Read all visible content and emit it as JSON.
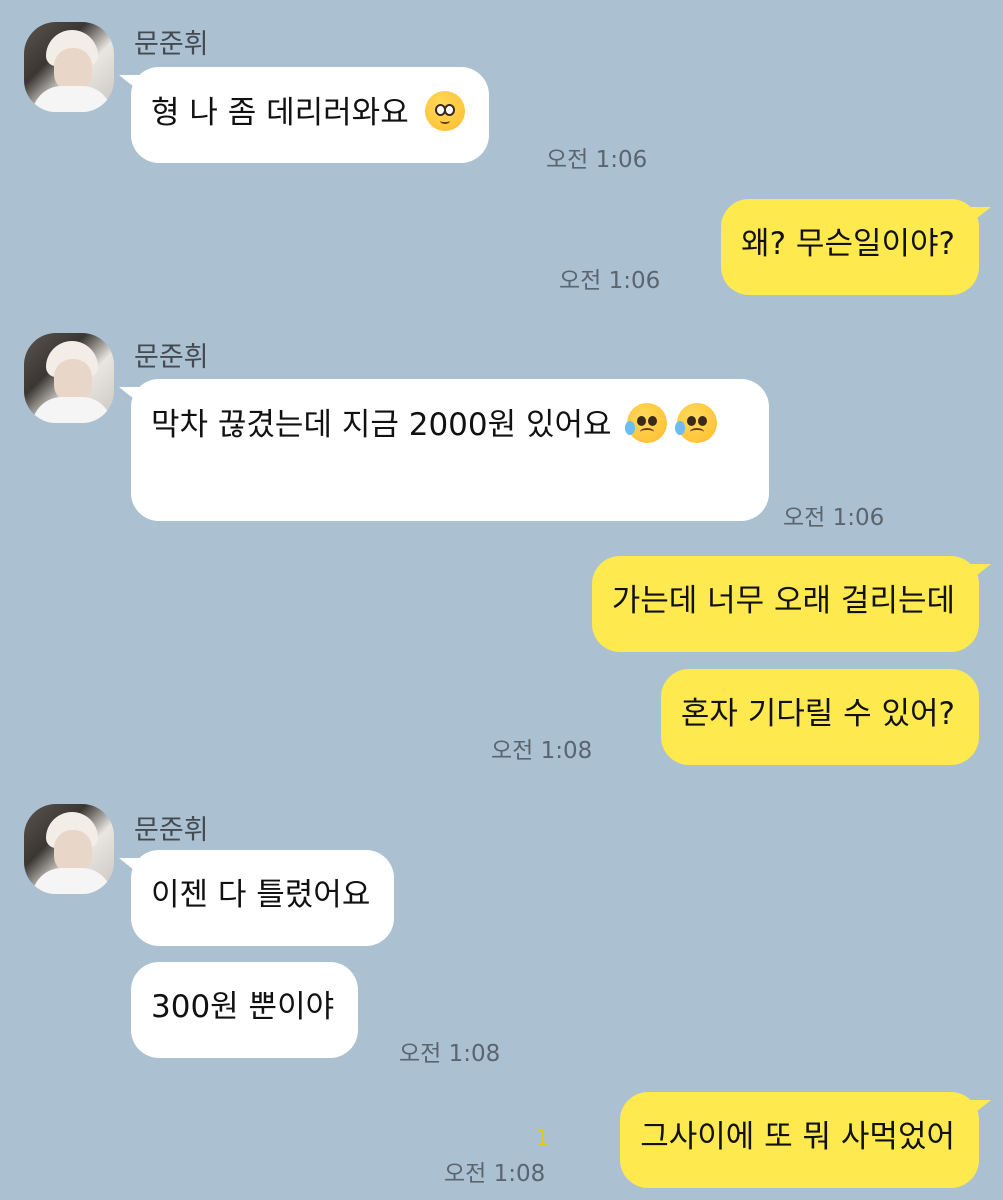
{
  "contact": {
    "name": "문준휘"
  },
  "messages": {
    "m1": {
      "text": "형 나 좀 데리러와요",
      "time": "오전 1:06",
      "emoji": "pleading-face-icon"
    },
    "m2": {
      "text": "왜? 무슨일이야?",
      "time": "오전 1:06"
    },
    "m3": {
      "text": "막차 끊겼는데 지금 2000원 있어요",
      "time": "오전 1:06",
      "emoji": "sad-sweat-face-icon"
    },
    "m4": {
      "text": "가는데 너무 오래 걸리는데"
    },
    "m5": {
      "text": "혼자 기다릴 수 있어?",
      "time": "오전 1:08"
    },
    "m6": {
      "text": "이젠 다 틀렸어요"
    },
    "m7": {
      "text": "300원 뿐이야",
      "time": "오전 1:08"
    },
    "m8": {
      "text": "그사이에 또 뭐 사먹었어",
      "time": "오전 1:08",
      "unread": "1"
    }
  },
  "colors": {
    "background": "#abc1d1",
    "incoming_bubble": "#ffffff",
    "outgoing_bubble": "#fee94e",
    "unread": "#e3c818"
  }
}
